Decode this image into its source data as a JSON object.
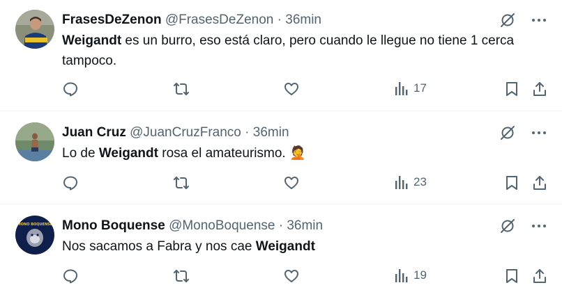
{
  "tweets": [
    {
      "name": "FrasesDeZenon",
      "handle": "@FrasesDeZenon",
      "separator": "·",
      "time": "36min",
      "text_bold": "Weigandt",
      "text_rest": " es un burro, eso está claro, pero cuando le llegue no tiene 1 cerca tampoco.",
      "views": "17"
    },
    {
      "name": "Juan Cruz",
      "handle": "@JuanCruzFranco",
      "separator": "·",
      "time": "36min",
      "text_pre": "Lo de ",
      "text_bold": "Weigandt",
      "text_rest": " rosa el amateurismo. 🤦",
      "views": "23"
    },
    {
      "name": "Mono Boquense",
      "handle": "@MonoBoquense",
      "separator": "·",
      "time": "36min",
      "text_pre": "Nos sacamos a Fabra y nos cae ",
      "text_bold": "Weigandt",
      "views": "19"
    }
  ],
  "avatar3_logo_text": "MONO BOQUENSE",
  "icons": {
    "reply": "reply-icon",
    "retweet": "retweet-icon",
    "like": "heart-icon",
    "views": "views-icon",
    "bookmark": "bookmark-icon",
    "share": "share-icon",
    "grok": "grok-icon",
    "more": "more-icon"
  },
  "colors": {
    "text": "#0f1419",
    "secondary": "#536471",
    "divider": "#eff3f4"
  }
}
